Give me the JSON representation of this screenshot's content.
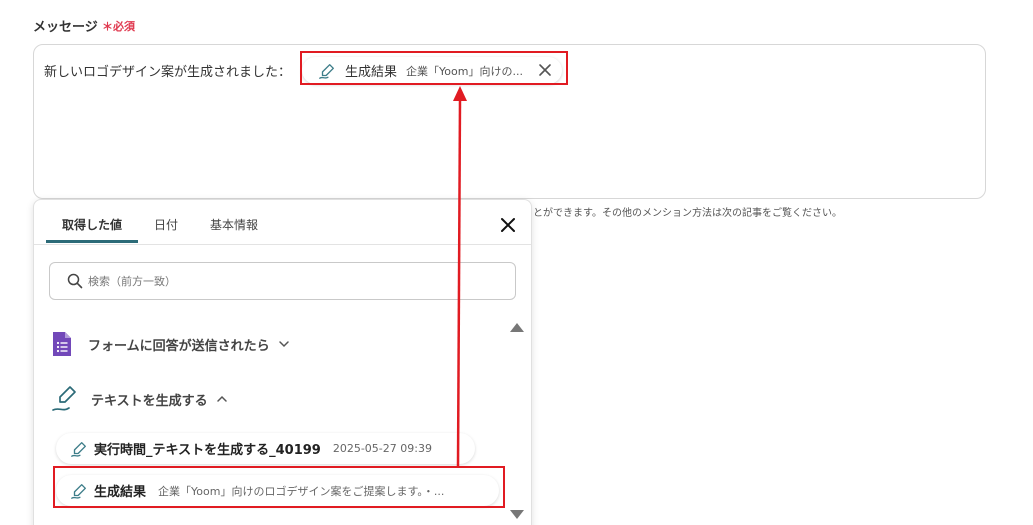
{
  "field": {
    "label": "メッセージ",
    "required_mark": "＊必須"
  },
  "message": {
    "prefix": "新しいロゴデザイン案が生成されました：",
    "chip": {
      "label": "生成結果",
      "preview": "企業「Yoom」向けの..."
    }
  },
  "hint": "とができます。その他のメンション方法は次の記事をご覧ください。",
  "panel": {
    "tabs": [
      {
        "label": "取得した値"
      },
      {
        "label": "日付"
      },
      {
        "label": "基本情報"
      }
    ],
    "search_placeholder": "検索（前方一致）",
    "groups": [
      {
        "label": "フォームに回答が送信されたら",
        "icon": "google-forms-icon",
        "expanded": false
      },
      {
        "label": "テキストを生成する",
        "icon": "ai-pen-icon",
        "expanded": true
      }
    ],
    "items": [
      {
        "label": "実行時間_テキストを生成する_40199",
        "sub": "2025-05-27 09:39"
      },
      {
        "label": "生成結果",
        "sub": "企業「Yoom」向けのロゴデザイン案をご提案します。・..."
      }
    ]
  },
  "colors": {
    "accent": "#2c6b78",
    "required": "#e0394f",
    "highlight": "#e11b22",
    "forms_purple": "#7248b9"
  }
}
